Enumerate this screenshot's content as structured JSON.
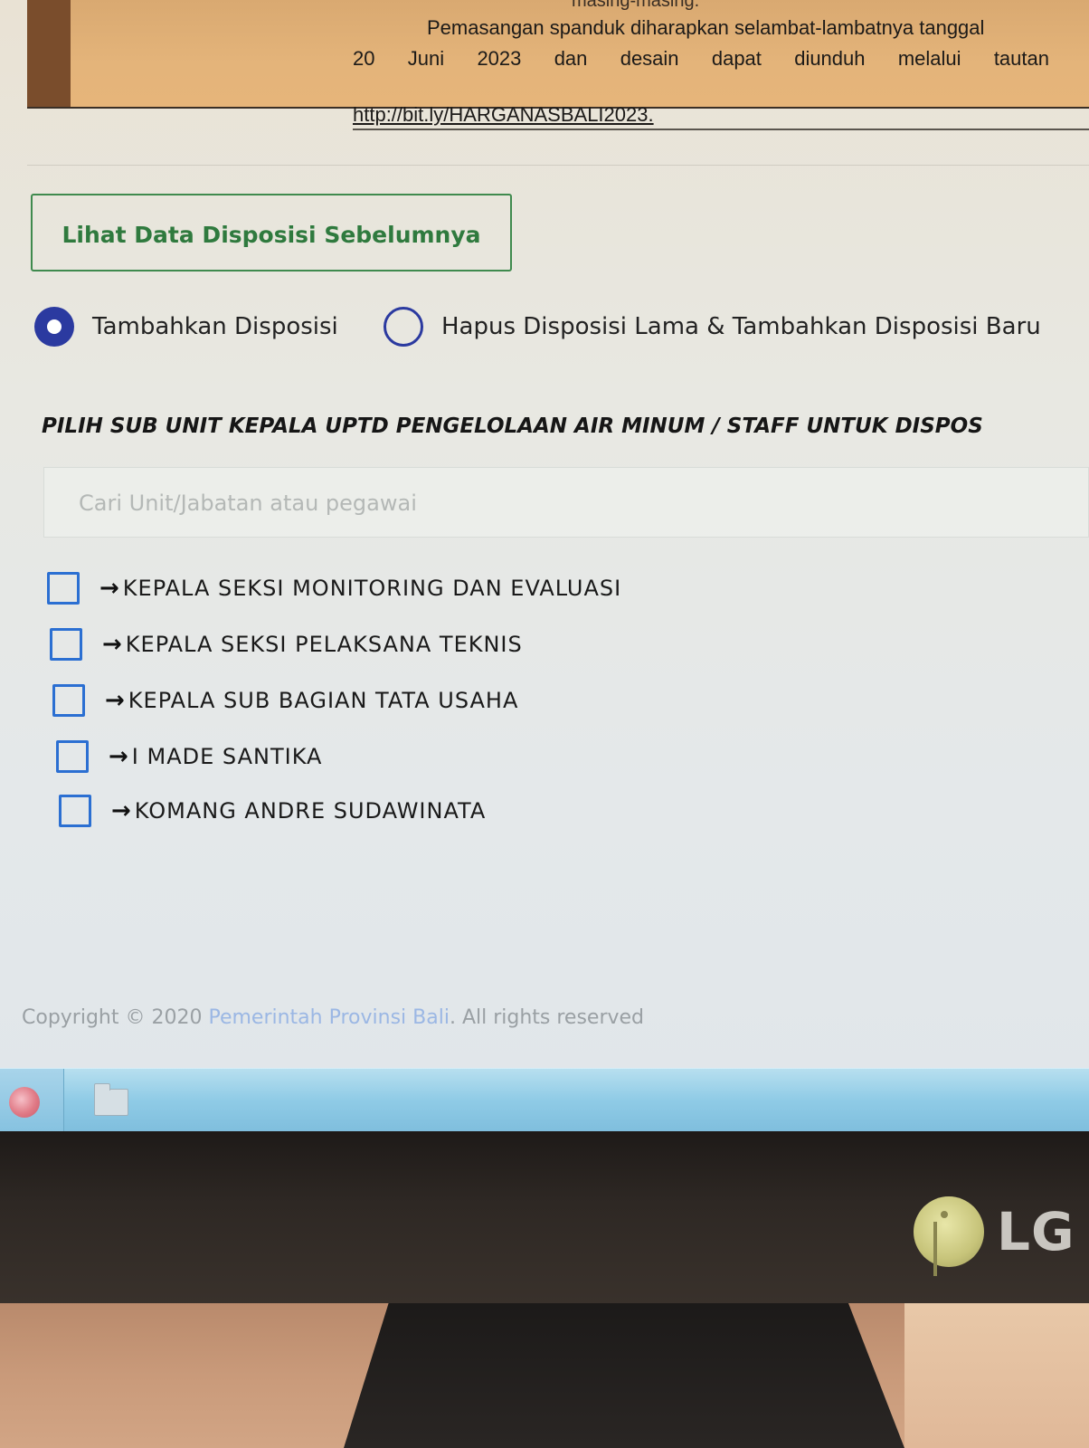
{
  "document": {
    "line_partial": "masing-masing.",
    "line1": "Pemasangan spanduk diharapkan selambat-lambatnya tanggal",
    "line2_words": [
      "20",
      "Juni",
      "2023",
      "dan",
      "desain",
      "dapat",
      "diunduh",
      "melalui",
      "tautan"
    ],
    "link": "http://bit.ly/HARGANASBALI2023."
  },
  "button_prev": {
    "label": "Lihat Data Disposisi Sebelumnya"
  },
  "radios": {
    "options": [
      {
        "label": "Tambahkan Disposisi",
        "checked": true
      },
      {
        "label": "Hapus Disposisi Lama & Tambahkan Disposisi Baru",
        "checked": false
      }
    ]
  },
  "section": {
    "title": "PILIH SUB UNIT KEPALA UPTD PENGELOLAAN AIR MINUM / STAFF UNTUK DISPOS"
  },
  "search": {
    "placeholder": "Cari Unit/Jabatan atau pegawai",
    "value": ""
  },
  "checklist": {
    "arrow": "→",
    "items": [
      {
        "label": "KEPALA SEKSI MONITORING DAN EVALUASI",
        "checked": false
      },
      {
        "label": "KEPALA SEKSI PELAKSANA TEKNIS",
        "checked": false
      },
      {
        "label": "KEPALA SUB BAGIAN TATA USAHA",
        "checked": false
      },
      {
        "label": "I MADE SANTIKA",
        "checked": false
      },
      {
        "label": "KOMANG ANDRE SUDAWINATA",
        "checked": false
      }
    ]
  },
  "footer": {
    "prefix": "Copyright © 2020 ",
    "org": "Pemerintah Provinsi Bali",
    "suffix": ". All rights reserved"
  },
  "monitor": {
    "brand": "LG"
  },
  "colors": {
    "accent_blue": "#2b3aa0",
    "checkbox_blue": "#2b6fd2",
    "button_green": "#2f7a3e",
    "footer_link": "#9bb7e4"
  },
  "icons": {
    "start": "start-orb-icon",
    "folder": "folder-icon"
  }
}
